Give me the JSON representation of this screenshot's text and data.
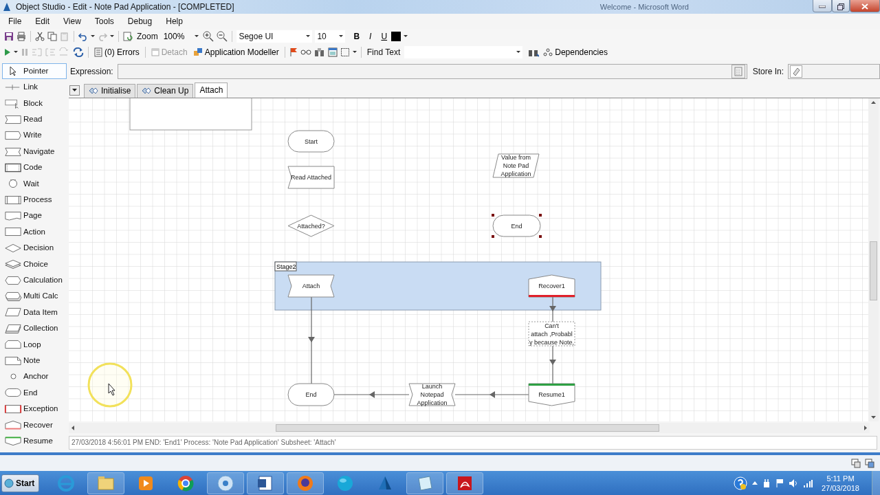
{
  "window": {
    "title": "Object Studio  - Edit - Note Pad Application - [COMPLETED]",
    "background_title": "Welcome - Microsoft Word"
  },
  "menu": [
    "File",
    "Edit",
    "View",
    "Tools",
    "Debug",
    "Help"
  ],
  "toolbar": {
    "zoom_label": "Zoom",
    "zoom": "100%",
    "font": "Segoe UI",
    "font_size": "10",
    "bold": "B",
    "italic": "I",
    "underline": "U"
  },
  "debug_toolbar": {
    "errors": "(0) Errors",
    "detach": {
      "label": "Detach",
      "disabled": true
    },
    "app_modeller": "Application Modeller",
    "find_label": "Find Text",
    "dependencies": "Dependencies"
  },
  "palette": [
    {
      "kind": "pointer",
      "label": "Pointer",
      "selected": true
    },
    {
      "kind": "link",
      "label": "Link",
      "selected": false
    },
    {
      "kind": "block",
      "label": "Block",
      "selected": false
    },
    {
      "kind": "read",
      "label": "Read",
      "selected": false
    },
    {
      "kind": "write",
      "label": "Write",
      "selected": false
    },
    {
      "kind": "navigate",
      "label": "Navigate",
      "selected": false
    },
    {
      "kind": "code",
      "label": "Code",
      "selected": false
    },
    {
      "kind": "wait",
      "label": "Wait",
      "selected": false
    },
    {
      "kind": "process",
      "label": "Process",
      "selected": false
    },
    {
      "kind": "page",
      "label": "Page",
      "selected": false
    },
    {
      "kind": "action",
      "label": "Action",
      "selected": false
    },
    {
      "kind": "decision",
      "label": "Decision",
      "selected": false
    },
    {
      "kind": "choice",
      "label": "Choice",
      "selected": false
    },
    {
      "kind": "calculation",
      "label": "Calculation",
      "selected": false
    },
    {
      "kind": "multicalc",
      "label": "Multi Calc",
      "selected": false
    },
    {
      "kind": "dataitem",
      "label": "Data Item",
      "selected": false
    },
    {
      "kind": "collection",
      "label": "Collection",
      "selected": false
    },
    {
      "kind": "loop",
      "label": "Loop",
      "selected": false
    },
    {
      "kind": "note",
      "label": "Note",
      "selected": false
    },
    {
      "kind": "anchor",
      "label": "Anchor",
      "selected": false
    },
    {
      "kind": "end",
      "label": "End",
      "selected": false
    },
    {
      "kind": "exception",
      "label": "Exception",
      "selected": false
    },
    {
      "kind": "recover",
      "label": "Recover",
      "selected": false
    },
    {
      "kind": "resume",
      "label": "Resume",
      "selected": false
    }
  ],
  "expression": {
    "label": "Expression:",
    "store_label": "Store In:"
  },
  "tabs": [
    {
      "label": "Initialise",
      "selected": false
    },
    {
      "label": "Clean Up",
      "selected": false
    },
    {
      "label": "Attach",
      "selected": true
    }
  ],
  "diagram": {
    "stage": "Stage2",
    "nodes": [
      {
        "kind": "terminal",
        "lines": [
          "Start"
        ],
        "selected": false
      },
      {
        "kind": "dataitem",
        "lines": [
          "Value from",
          "Note Pad",
          "Application"
        ],
        "selected": false
      },
      {
        "kind": "read",
        "lines": [
          "Read Attached"
        ],
        "selected": false
      },
      {
        "kind": "decision",
        "lines": [
          "Attached?"
        ],
        "selected": false
      },
      {
        "kind": "terminal",
        "lines": [
          "End"
        ],
        "selected": true
      },
      {
        "kind": "navigate",
        "lines": [
          "Attach"
        ],
        "selected": false
      },
      {
        "kind": "recover",
        "lines": [
          "Recover1"
        ],
        "selected": false
      },
      {
        "kind": "note",
        "lines": [
          "Can't",
          "attach ,Probabl",
          "y because Note,"
        ],
        "selected": false
      },
      {
        "kind": "terminal",
        "lines": [
          "End"
        ],
        "selected": false
      },
      {
        "kind": "navigate",
        "lines": [
          "Launch",
          "Notepad",
          "Application"
        ],
        "selected": false
      },
      {
        "kind": "resume",
        "lines": [
          "Resume1"
        ],
        "selected": false
      }
    ]
  },
  "status": "27/03/2018 4:56:01 PM END: 'End1' Process: 'Note Pad Application' Subsheet: 'Attach'",
  "taskbar": {
    "start": "Start",
    "time": "5:11 PM",
    "date": "27/03/2018"
  }
}
